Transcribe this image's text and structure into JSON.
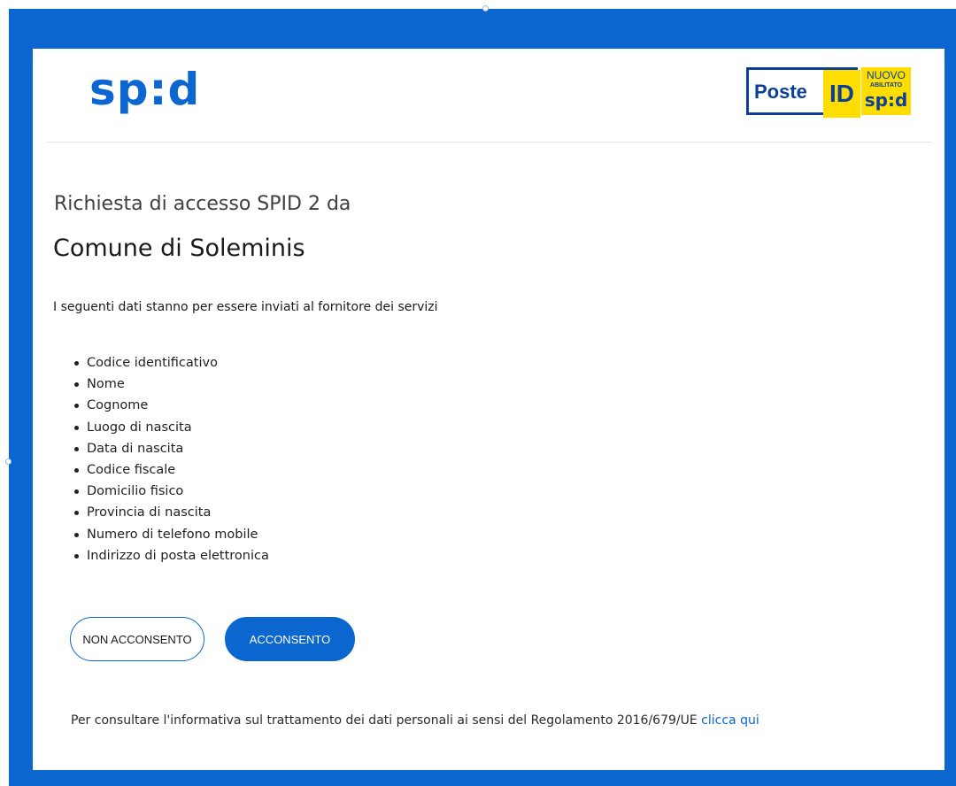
{
  "header": {
    "spid_logo": "sp:d",
    "poste_logo": {
      "text": "Poste",
      "id": "ID",
      "nuovo": "NUOVO",
      "abilitato": "ABILITATO",
      "spid": "sp:d"
    }
  },
  "request": {
    "title": "Richiesta di accesso SPID 2 da",
    "entity": "Comune di Soleminis",
    "intro": "I seguenti dati stanno per essere inviati al fornitore dei servizi",
    "attributes": [
      "Codice identificativo",
      "Nome",
      "Cognome",
      "Luogo di nascita",
      "Data di nascita",
      "Codice fiscale",
      "Domicilio fisico",
      "Provincia di nascita",
      "Numero di telefono mobile",
      "Indirizzo di posta elettronica"
    ]
  },
  "actions": {
    "deny_label": "NON ACCONSENTO",
    "accept_label": "ACCONSENTO"
  },
  "footer": {
    "privacy_text": "Per consultare l'informativa sul trattamento dei dati personali ai sensi del Regolamento 2016/679/UE",
    "privacy_link": "clicca qui"
  },
  "colors": {
    "brand_blue": "#0b66d0",
    "poste_yellow": "#ffdd00",
    "poste_navy": "#0b3f9a"
  }
}
